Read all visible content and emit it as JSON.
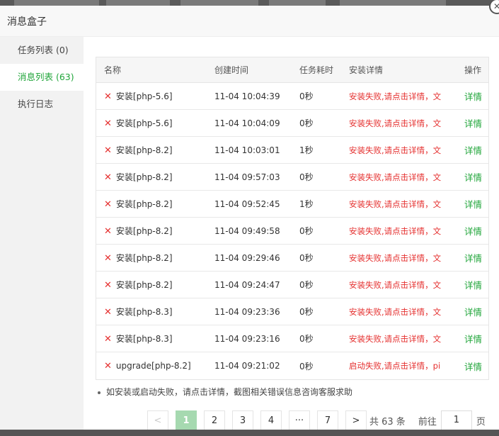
{
  "dialog": {
    "title": "消息盒子",
    "close_glyph": "✕"
  },
  "sidebar": {
    "items": [
      {
        "label": "任务列表 (0)"
      },
      {
        "label": "消息列表 (63)"
      },
      {
        "label": "执行日志"
      }
    ]
  },
  "table": {
    "headers": [
      "名称",
      "创建时间",
      "任务耗时",
      "安装详情",
      "操作"
    ],
    "rows": [
      {
        "name": "安装[php-5.6]",
        "time": "11-04 10:04:39",
        "dur": "0秒",
        "detail": "安装失败,请点击详情，文",
        "op": "详情"
      },
      {
        "name": "安装[php-5.6]",
        "time": "11-04 10:04:09",
        "dur": "0秒",
        "detail": "安装失败,请点击详情，文",
        "op": "详情"
      },
      {
        "name": "安装[php-8.2]",
        "time": "11-04 10:03:01",
        "dur": "1秒",
        "detail": "安装失败,请点击详情，文",
        "op": "详情"
      },
      {
        "name": "安装[php-8.2]",
        "time": "11-04 09:57:03",
        "dur": "0秒",
        "detail": "安装失败,请点击详情，文",
        "op": "详情"
      },
      {
        "name": "安装[php-8.2]",
        "time": "11-04 09:52:45",
        "dur": "1秒",
        "detail": "安装失败,请点击详情，文",
        "op": "详情"
      },
      {
        "name": "安装[php-8.2]",
        "time": "11-04 09:49:58",
        "dur": "0秒",
        "detail": "安装失败,请点击详情，文",
        "op": "详情"
      },
      {
        "name": "安装[php-8.2]",
        "time": "11-04 09:29:46",
        "dur": "0秒",
        "detail": "安装失败,请点击详情，文",
        "op": "详情"
      },
      {
        "name": "安装[php-8.2]",
        "time": "11-04 09:24:47",
        "dur": "0秒",
        "detail": "安装失败,请点击详情，文",
        "op": "详情"
      },
      {
        "name": "安装[php-8.3]",
        "time": "11-04 09:23:36",
        "dur": "0秒",
        "detail": "安装失败,请点击详情，文",
        "op": "详情"
      },
      {
        "name": "安装[php-8.3]",
        "time": "11-04 09:23:16",
        "dur": "0秒",
        "detail": "安装失败,请点击详情，文",
        "op": "详情"
      },
      {
        "name": "upgrade[php-8.2]",
        "time": "11-04 09:21:02",
        "dur": "0秒",
        "detail": "启动失败,请点击详情，pi",
        "op": "详情"
      }
    ],
    "fail_icon": "✕"
  },
  "tip": "如安装或启动失败，请点击详情，截图相关错误信息咨询客服求助",
  "pager": {
    "prev": "<",
    "pages": [
      "1",
      "2",
      "3",
      "4",
      "···",
      "7"
    ],
    "next": ">",
    "total": "共 63 条",
    "goto_label": "前往",
    "goto_value": "1",
    "goto_suffix": "页"
  },
  "colors": {
    "accent": "#20a53a",
    "error": "#e5302f"
  }
}
